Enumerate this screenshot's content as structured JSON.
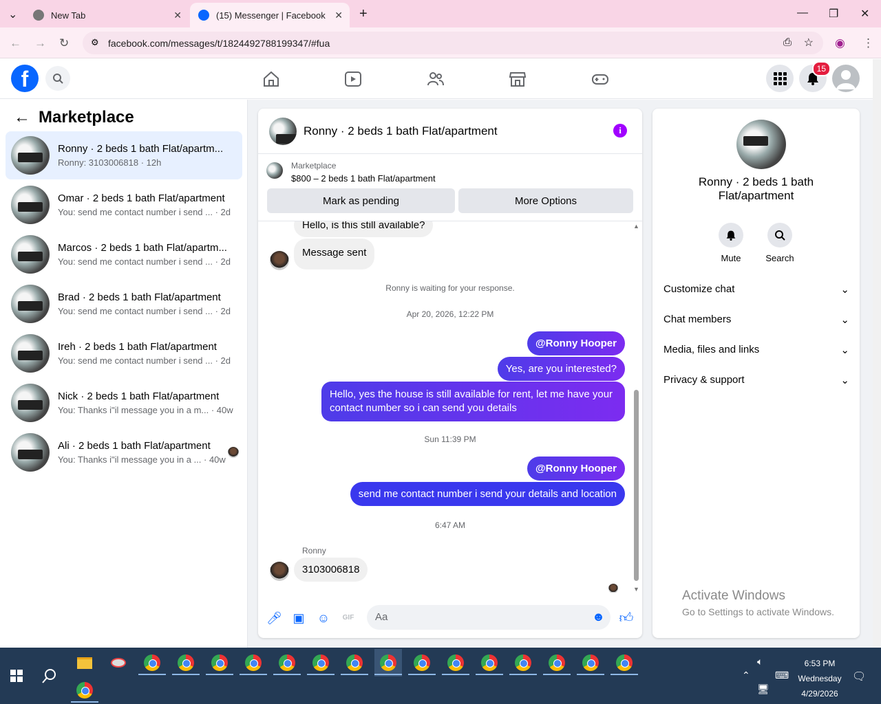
{
  "browser": {
    "tabs": [
      {
        "label": "New Tab"
      },
      {
        "label": "(15) Messenger | Facebook"
      }
    ],
    "url": "facebook.com/messages/t/1824492788199347/#fua"
  },
  "facebook": {
    "notification_count": "15"
  },
  "left_panel": {
    "title": "Marketplace",
    "conversations": [
      {
        "name": "Ronny · 2 beds 1 bath Flat/apartm...",
        "preview": "Ronny: 3103006818 · 12h"
      },
      {
        "name": "Omar · 2 beds 1 bath Flat/apartment",
        "preview": "You: send me contact number i send ... · 2d"
      },
      {
        "name": "Marcos · 2 beds 1 bath Flat/apartm...",
        "preview": "You: send me contact number i send ... · 2d"
      },
      {
        "name": "Brad · 2 beds 1 bath Flat/apartment",
        "preview": "You: send me contact number i send ... · 2d"
      },
      {
        "name": "Ireh · 2 beds 1 bath Flat/apartment",
        "preview": "You: send me contact number i send ... · 2d"
      },
      {
        "name": "Nick · 2 beds 1 bath Flat/apartment",
        "preview": "You: Thanks i\"il message you in a m... · 40w"
      },
      {
        "name": "Ali · 2 beds 1 bath Flat/apartment",
        "preview": "You: Thanks i\"il message you in a ... · 40w"
      }
    ]
  },
  "chat": {
    "title": "Ronny · 2 beds 1 bath Flat/apartment",
    "marketplace_label": "Marketplace",
    "listing": "$800 – 2 beds 1 bath Flat/apartment",
    "mark_pending": "Mark as pending",
    "more_options": "More Options",
    "messages": {
      "m1": "Hello, is this still available?",
      "m2": "Message sent",
      "waiting": "Ronny is waiting for your response.",
      "ts1": "Apr 20, 2026, 12:22 PM",
      "m3": "@Ronny Hooper",
      "m4": "Yes, are you interested?",
      "m5a": "Hello, yes the house is still available for rent, let me have your",
      "m5b": "contact number so i can send you details",
      "ts2": "Sun 11:39 PM",
      "m6": "@Ronny Hooper",
      "m7": "send me contact number i send your details and location",
      "ts3": "6:47 AM",
      "sender": "Ronny",
      "m8": "3103006818"
    },
    "composer_placeholder": "Aa"
  },
  "right_panel": {
    "name_line1": "Ronny · 2 beds 1 bath",
    "name_line2": "Flat/apartment",
    "mute": "Mute",
    "search": "Search",
    "sections": [
      "Customize chat",
      "Chat members",
      "Media, files and links",
      "Privacy & support"
    ]
  },
  "watermark": {
    "title": "Activate Windows",
    "sub": "Go to Settings to activate Windows."
  },
  "taskbar": {
    "time": "6:53 PM",
    "day": "Wednesday",
    "date": "4/29/2026"
  }
}
